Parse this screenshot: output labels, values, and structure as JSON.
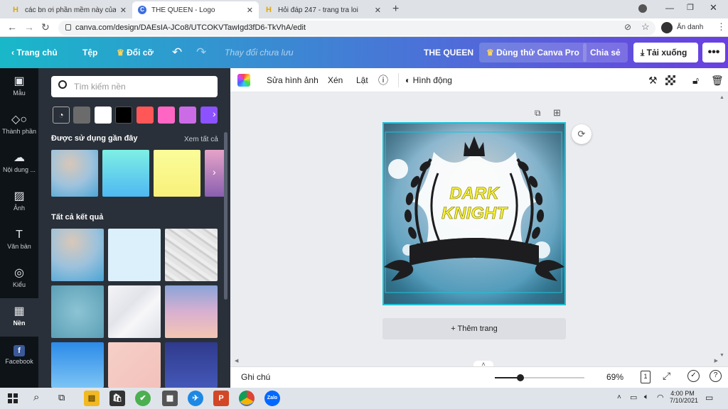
{
  "browser": {
    "tabs": [
      {
        "title": "các bn ơi phần mềm này của mk",
        "favicon": "H"
      },
      {
        "title": "THE QUEEN - Logo",
        "favicon": "C"
      },
      {
        "title": "Hỏi đáp 247 - trang tra loi",
        "favicon": "H"
      }
    ],
    "url": "canva.com/design/DAEsIA-JCo8/UTCOKVTawIgd3fD6-TkVhA/edit",
    "profile_label": "Ẩn danh"
  },
  "header": {
    "home": "Trang chủ",
    "file": "Tệp",
    "resize": "Đổi cỡ",
    "save_status": "Thay đổi chưa lưu",
    "design_title": "THE QUEEN",
    "try_pro": "Dùng thử Canva Pro",
    "share": "Chia sẻ",
    "download": "Tải xuống"
  },
  "rail": [
    {
      "label": "Mẫu",
      "icon": "template-icon"
    },
    {
      "label": "Thành phần",
      "icon": "elements-icon"
    },
    {
      "label": "Nội dung ...",
      "icon": "upload-icon"
    },
    {
      "label": "Ảnh",
      "icon": "photo-icon"
    },
    {
      "label": "Văn bản",
      "icon": "text-icon"
    },
    {
      "label": "Kiểu",
      "icon": "styles-icon"
    },
    {
      "label": "Nền",
      "icon": "background-icon"
    },
    {
      "label": "Facebook",
      "icon": "facebook-icon"
    }
  ],
  "panel": {
    "search_placeholder": "Tìm kiếm nền",
    "recent_title": "Được sử dụng gần đây",
    "see_all": "Xem tất cả",
    "all_results": "Tất cả kết quả",
    "swatch_colors": [
      "#6b6b6b",
      "#ffffff",
      "#000000",
      "#ff5757",
      "#ff66c4",
      "#cb6ce6",
      "#8c52ff"
    ]
  },
  "context_toolbar": {
    "edit_image": "Sửa hình ảnh",
    "crop": "Xén",
    "flip": "Lật",
    "animate": "Hình động"
  },
  "design": {
    "line1": "DARK",
    "line2": "KNIGHT"
  },
  "canvas": {
    "add_page": "+ Thêm trang"
  },
  "bottombar": {
    "notes": "Ghi chú",
    "zoom": "69%",
    "zoom_value": 0.69,
    "page_count": "1"
  },
  "taskbar": {
    "time": "4:00 PM",
    "date": "7/10/2021"
  }
}
